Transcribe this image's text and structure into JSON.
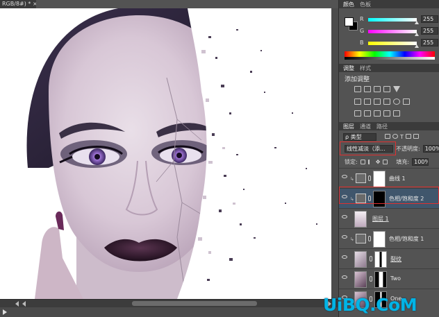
{
  "document": {
    "tab_label": "RGB/8#) * ×"
  },
  "color_panel": {
    "tabs": [
      "颜色",
      "色板"
    ],
    "sliders": [
      {
        "label": "R",
        "value": "255",
        "gradient": "linear-gradient(to right,#00ffff,#ffffff)"
      },
      {
        "label": "G",
        "value": "255",
        "gradient": "linear-gradient(to right,#ff00ff,#ffffff)"
      },
      {
        "label": "B",
        "value": "255",
        "gradient": "linear-gradient(to right,#ffff00,#ffffff)"
      }
    ],
    "foreground": "#ffffff",
    "background": "#000000"
  },
  "adjustments_panel": {
    "tabs": [
      "调整",
      "样式"
    ],
    "title": "添加调整"
  },
  "layers_panel": {
    "tabs": [
      "图层",
      "通道",
      "路径"
    ],
    "filter_kind": "ρ 类型",
    "blend_mode": "线性减淡（添...",
    "opacity_label": "不透明度:",
    "opacity_value": "100%",
    "lock_label": "锁定:",
    "fill_label": "填充:",
    "fill_value": "100%",
    "layers": [
      {
        "name": "曲线 1",
        "kind": "adjustment",
        "selected": false
      },
      {
        "name": "色相/饱和度 2",
        "kind": "adjustment",
        "selected": true,
        "mask": "black"
      },
      {
        "name": "图层 1",
        "kind": "pixel",
        "selected": false
      },
      {
        "name": "色相/饱和度 1",
        "kind": "adjustment",
        "selected": false
      },
      {
        "name": "裂纹",
        "kind": "pixel",
        "selected": false
      },
      {
        "name": "Two",
        "kind": "pixel",
        "selected": false
      },
      {
        "name": "One",
        "kind": "pixel",
        "selected": false
      }
    ]
  },
  "watermark": "UiBQ.CoM"
}
